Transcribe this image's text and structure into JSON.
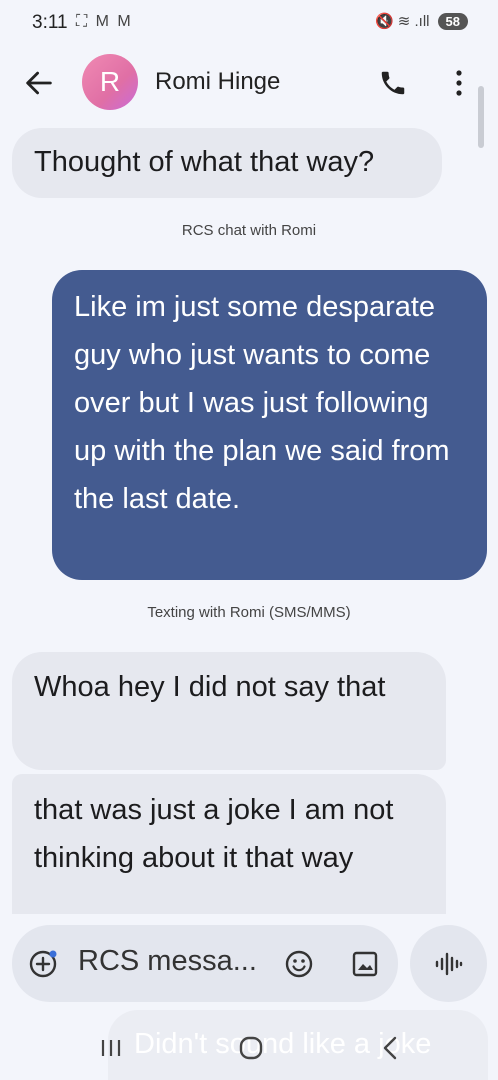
{
  "status_bar": {
    "time": "3:11",
    "left_icons": "⛶ M M",
    "right_icons": "🔇 ≋ .ıll",
    "battery": "58"
  },
  "header": {
    "avatar_letter": "R",
    "contact_name": "Romi Hinge",
    "back_icon": "arrow-left",
    "call_icon": "phone",
    "more_icon": "more-vertical"
  },
  "messages": [
    {
      "direction": "incoming",
      "text": "Thought of what that way?"
    },
    {
      "direction": "outgoing",
      "text": "Like im just some desparate guy who just wants to come over but I was just following up with the plan we said from the last date."
    },
    {
      "direction": "incoming",
      "text": "Whoa hey I did not say that"
    },
    {
      "direction": "incoming",
      "text": "that was just a joke I am not thinking about it that way"
    }
  ],
  "info_labels": {
    "rcs": "RCS chat with Romi",
    "sms": "Texting with Romi (SMS/MMS)"
  },
  "composer": {
    "placeholder": "RCS messa...",
    "draft_preview": "Didn't sound like a joke"
  },
  "colors": {
    "outgoing_bubble": "#445b90",
    "incoming_bubble": "#e6e8ef",
    "background": "#f3f5fb"
  }
}
